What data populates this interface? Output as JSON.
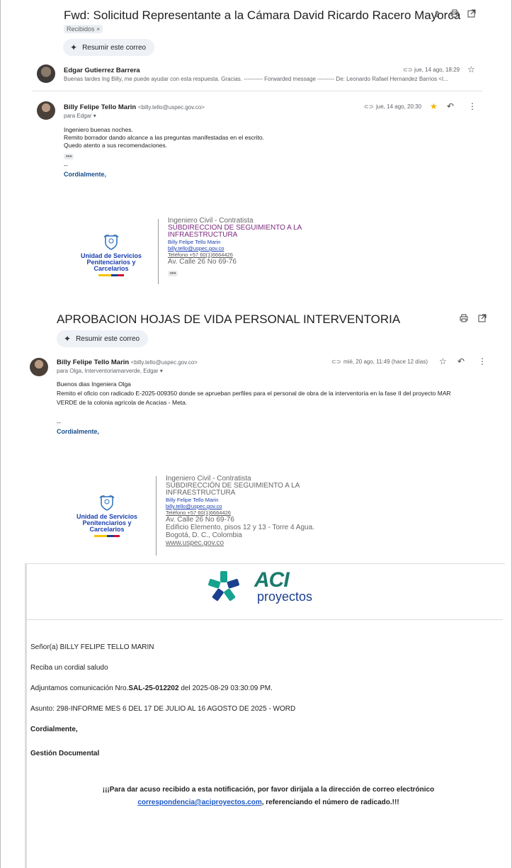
{
  "email1": {
    "subject": "Fwd: Solicitud Representante a la Cámara David Ricardo Racero Mayorca",
    "label_chip": "Recibidos ×",
    "summarize_label": "Resumir este correo",
    "msg1": {
      "sender": "Edgar Gutierrez Barrera",
      "date": "jue, 14 ago, 18:29",
      "snippet": "Buenas tardes Ing Billy, me puede ayudar con esta respuesta. Gracias. ---------- Forwarded message --------- De: Leonardo Rafael Hernandez Barrios <l..."
    },
    "msg2": {
      "sender": "Billy Felipe Tello Marin",
      "email": "<billy.tello@uspec.gov.co>",
      "to": "para Edgar ▾",
      "date": "jue, 14 ago, 20:30",
      "lines": [
        "Ingeniero buenas noches.",
        "Remito borrador dando alcance a las preguntas manifestadas en el escrito.",
        "Quedo atento a sus recomendaciones."
      ],
      "ellipsis": "•••",
      "dashes": "--",
      "closing": "Cordialmente,"
    },
    "signature": {
      "org_line1": "Unidad de Servicios",
      "org_line2": "Penitenciarios y Carcelarios",
      "role": "Ingeniero Civil - Contratista",
      "dept_line1": "SUBDIRECCION DE SEGUIMIENTO A LA",
      "dept_line2": "INFRAESTRUCTURA",
      "name": "Billy Felipe Tello Marin",
      "email": "billy.tello@uspec.gov.co",
      "phone": "Teléfono +57 60(1)6664426",
      "address": "Av. Calle 26 No 69-76",
      "ellipsis": "•••"
    }
  },
  "email2": {
    "subject": "APROBACION HOJAS DE VIDA PERSONAL INTERVENTORIA",
    "summarize_label": "Resumir este correo",
    "msg": {
      "sender": "Billy Felipe Tello Marin",
      "email": "<billy.tello@uspec.gov.co>",
      "to": "para Olga, Interventoriamarverde, Edgar ▾",
      "date": "mié, 20 ago, 11:49 (hace 12 días)",
      "line1": "Buenos dias Ingeniera Olga",
      "line2": "Remito el oficio con radicado  E-2025-009350 donde se aprueban perfiles para el personal de obra de la interventoría en la fase II del proyecto MAR",
      "line3": "VERDE de la colonia agrícola de Acacias - Meta.",
      "dashes": "--",
      "closing": "Cordialmente,"
    },
    "signature": {
      "org_line1": "Unidad de Servicios",
      "org_line2": "Penitenciarios y Carcelarios",
      "role": "Ingeniero Civil - Contratista",
      "dept_line1": "SUBDIRECCIÓN DE SEGUIMIENTO A LA",
      "dept_line2": "INFRAESTRUCTURA",
      "name": "Billy Felipe Tello Marin",
      "email": "billy.tello@uspec.gov.co",
      "phone": "Teléfono +57 60(1)6664426",
      "address": "Av. Calle 26 No 69-76",
      "building": "Edificio Elemento, pisos 12 y 13 - Torre 4 Agua.",
      "city": "Bogotá, D. C., Colombia",
      "web": "www.uspec.gov.co"
    }
  },
  "aci": {
    "logo_top": "ACI",
    "logo_bottom": "proyectos",
    "greeting": "Señor(a) BILLY FELIPE TELLO MARIN",
    "salute": "Reciba un cordial saludo",
    "comm_prefix": "Adjuntamos comunicación Nro.",
    "comm_number": "SAL-25-012202",
    "comm_suffix": " del 2025-08-29 03:30:09 PM.",
    "subject_line": "Asunto: 298-INFORME MES 6 DEL 17 DE JULIO AL 16 AGOSTO DE 2025 - WORD",
    "closing": "Cordialmente,",
    "dept": "Gestión Documental",
    "notice_prefix": "¡¡¡Para dar acuso recibido a esta notificación, por favor dirijala a la dirección de correo electrónico",
    "notice_email": "correspondencia@aciproyectos.com",
    "notice_suffix": ", referenciando el número de radicado.!!!"
  },
  "colors": {
    "link_blue": "#1a3fb0",
    "aci_green": "#1a7a6e",
    "aci_blue": "#1b3f8f",
    "star_gold": "#f4b400"
  }
}
